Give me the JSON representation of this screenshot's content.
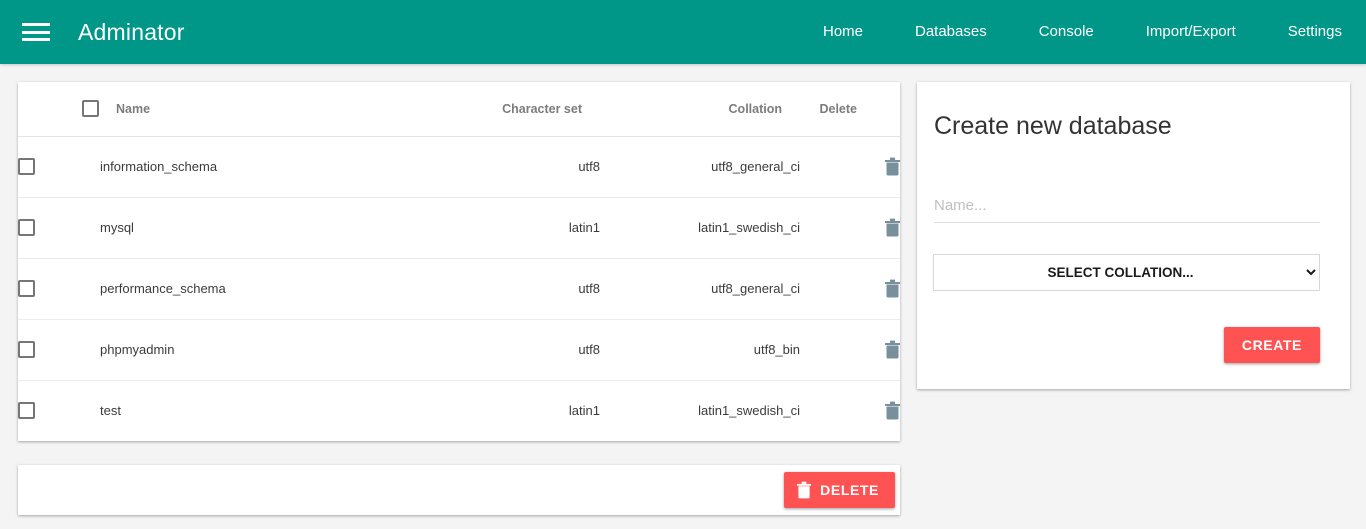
{
  "header": {
    "brand": "Adminator",
    "menu_icon": "hamburger-menu-icon",
    "background_color": "#009688",
    "nav": [
      {
        "label": "Home"
      },
      {
        "label": "Databases"
      },
      {
        "label": "Console"
      },
      {
        "label": "Import/Export"
      },
      {
        "label": "Settings"
      }
    ]
  },
  "table": {
    "columns": {
      "select_all": "",
      "name": "Name",
      "charset": "Character set",
      "collation": "Collation",
      "delete": "Delete"
    },
    "rows": [
      {
        "name": "information_schema",
        "charset": "utf8",
        "collation": "utf8_general_ci"
      },
      {
        "name": "mysql",
        "charset": "latin1",
        "collation": "latin1_swedish_ci"
      },
      {
        "name": "performance_schema",
        "charset": "utf8",
        "collation": "utf8_general_ci"
      },
      {
        "name": "phpmyadmin",
        "charset": "utf8",
        "collation": "utf8_bin"
      },
      {
        "name": "test",
        "charset": "latin1",
        "collation": "latin1_swedish_ci"
      }
    ],
    "row_delete_icon": "trash-icon"
  },
  "delete_bar": {
    "button_label": "DELETE",
    "button_icon": "trash-icon",
    "button_color": "#ff5252"
  },
  "create_panel": {
    "title": "Create new database",
    "name_placeholder": "Name...",
    "name_value": "",
    "collation_selected": "SELECT COLLATION...",
    "collation_icon": "chevron-down-icon",
    "create_label": "CREATE",
    "create_color": "#ff5252"
  }
}
